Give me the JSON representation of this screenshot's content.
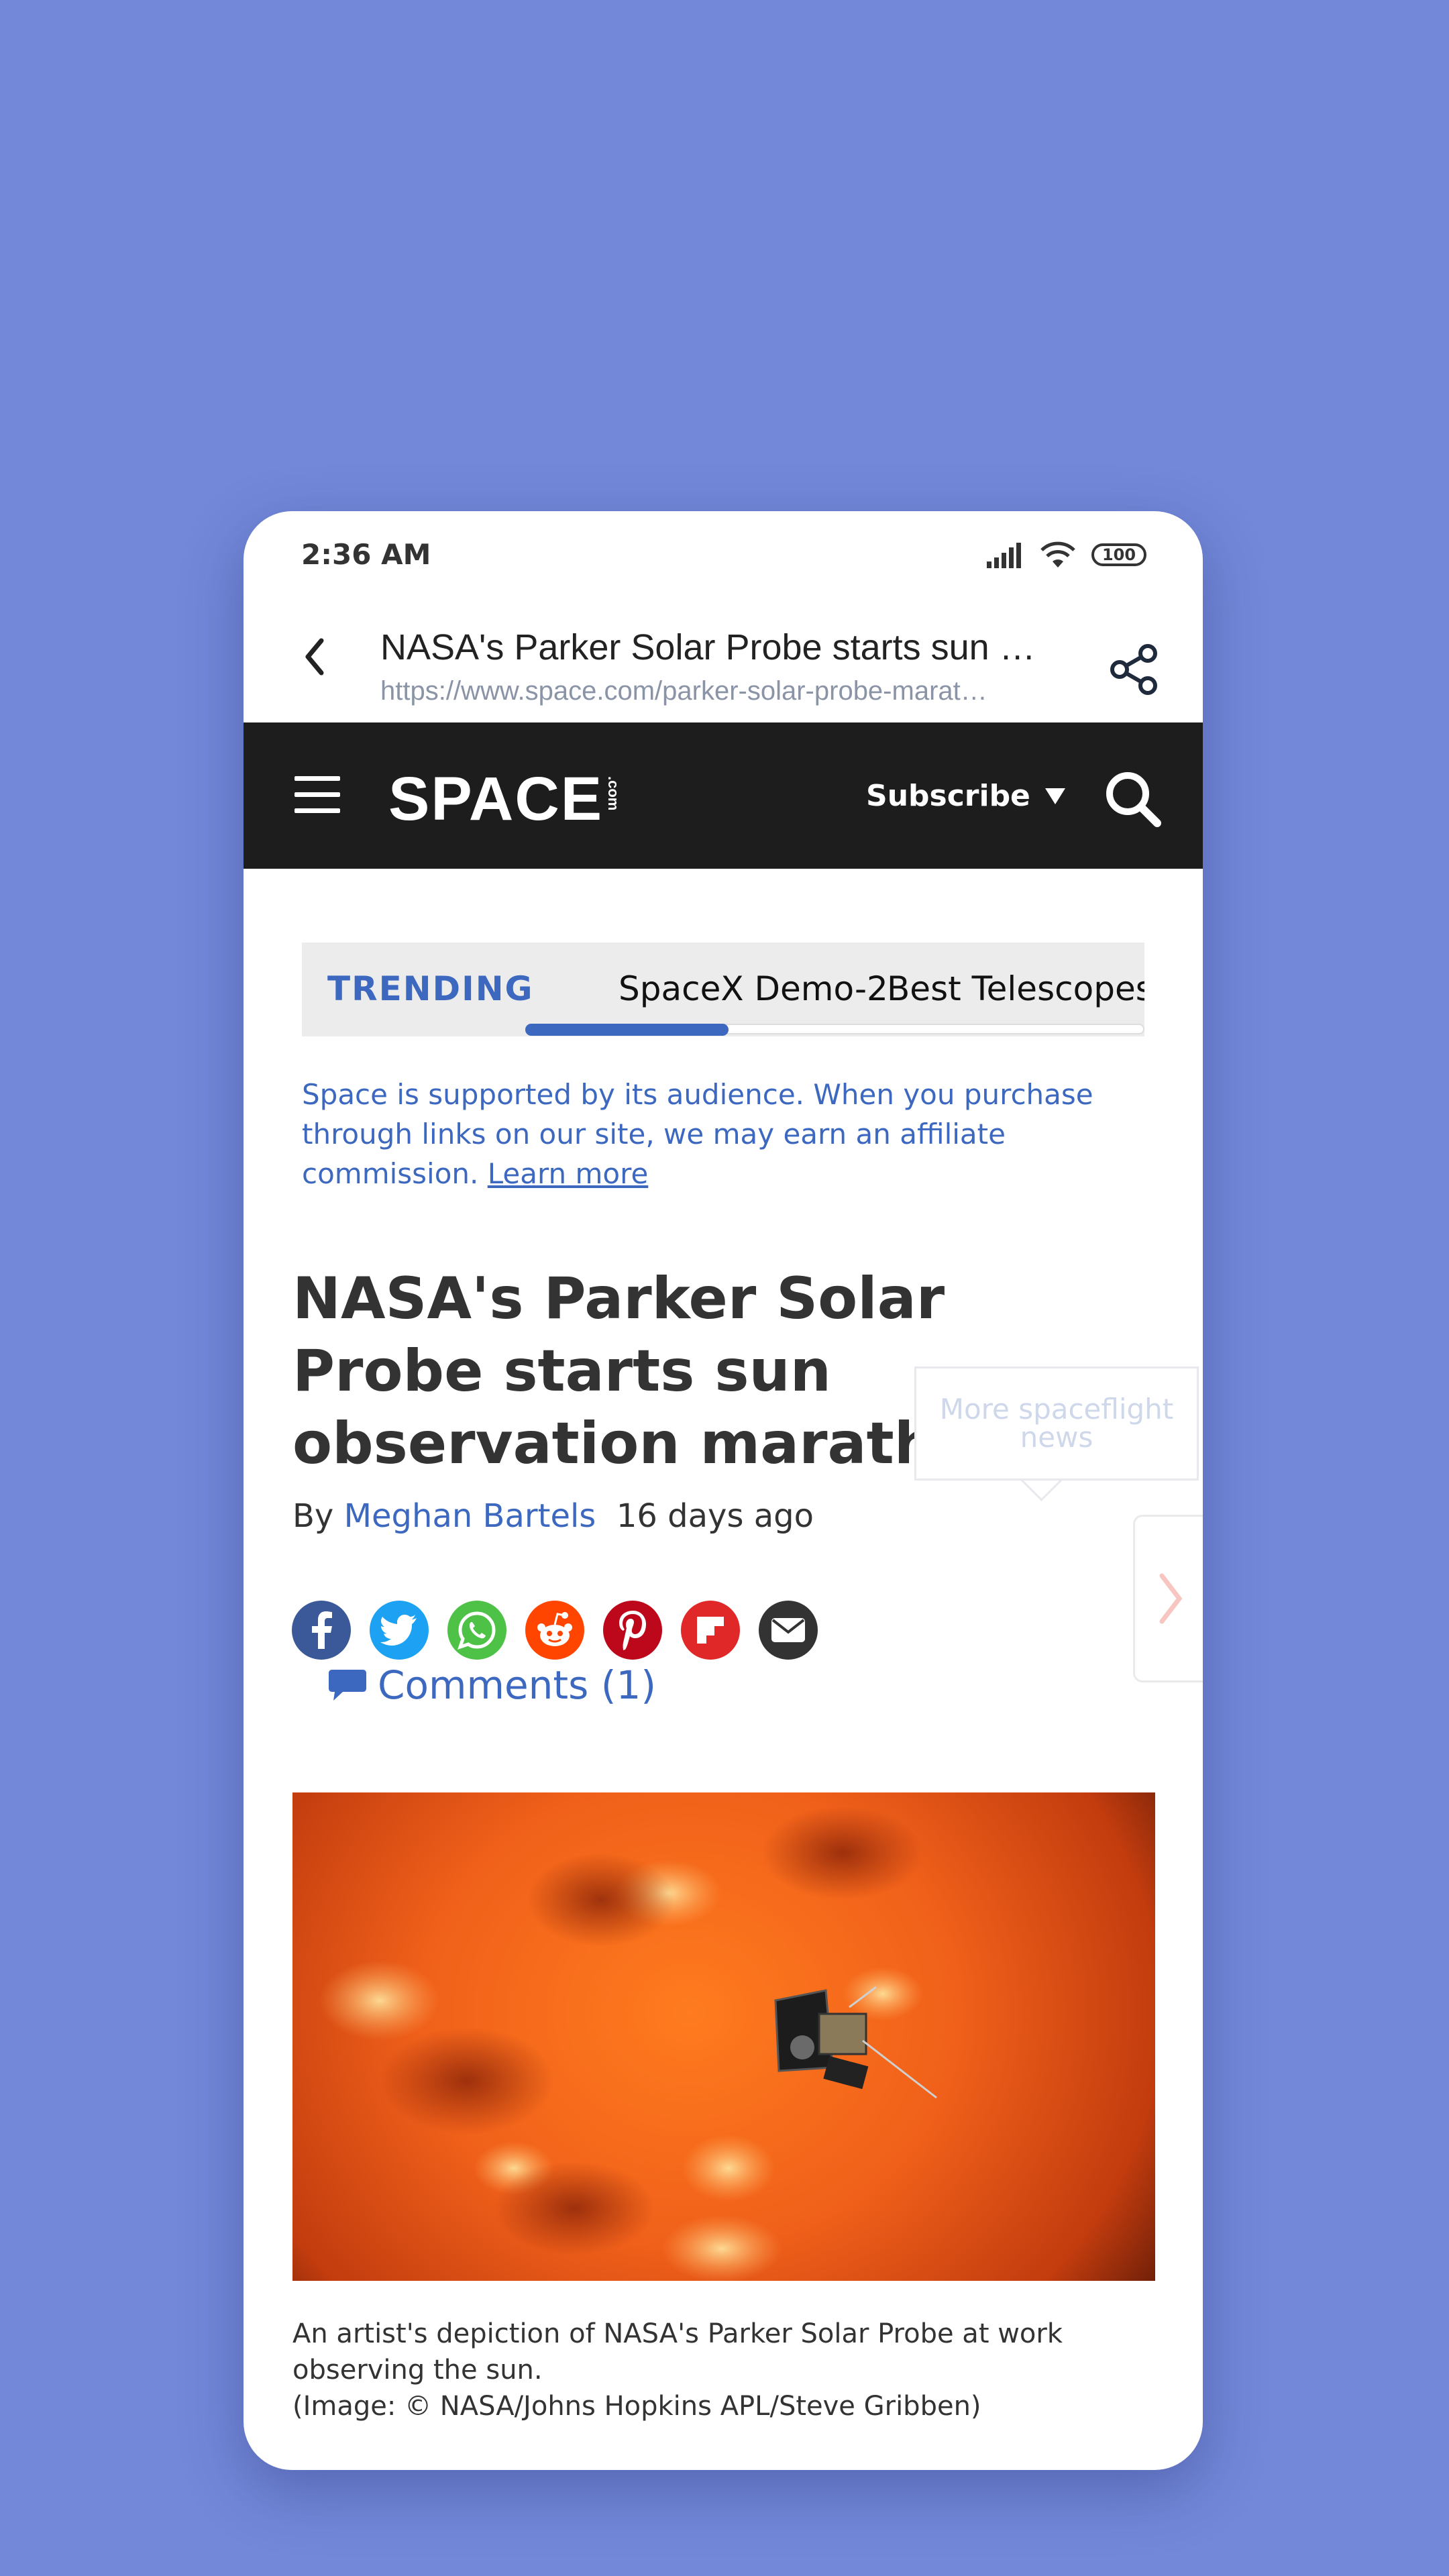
{
  "status_bar": {
    "time": "2:36 AM",
    "battery": "100"
  },
  "browser": {
    "page_title": "NASA's Parker Solar Probe starts sun o…",
    "url": "https://www.space.com/parker-solar-probe-marat…"
  },
  "site_header": {
    "logo_text": "SPACE",
    "logo_suffix": ".com",
    "subscribe_label": "Subscribe"
  },
  "trending": {
    "label": "TRENDING",
    "items": [
      "SpaceX Demo-2",
      "Best Telescopes"
    ]
  },
  "affiliate": {
    "text": "Space is supported by its audience. When you purchase through links on our site, we may earn an affiliate commission.",
    "link_label": "Learn more"
  },
  "article": {
    "headline": "NASA's Parker Solar Probe starts sun observation marathon",
    "by": "By",
    "author": "Meghan Bartels",
    "time_ago": "16 days ago",
    "comments_label": "Comments (1)",
    "caption_line1": "An artist's depiction of NASA's Parker Solar Probe at work observing the sun.",
    "caption_line2": "(Image: © NASA/Johns Hopkins APL/Steve Gribben)"
  },
  "more_box": {
    "label": "More spaceflight news"
  },
  "social": [
    {
      "name": "facebook-icon",
      "color": "#3b5998"
    },
    {
      "name": "twitter-icon",
      "color": "#1da1f2"
    },
    {
      "name": "whatsapp-icon",
      "color": "#4dc247"
    },
    {
      "name": "reddit-icon",
      "color": "#ff4500"
    },
    {
      "name": "pinterest-icon",
      "color": "#bd081c"
    },
    {
      "name": "flipboard-icon",
      "color": "#e12828"
    },
    {
      "name": "email-icon",
      "color": "#333333"
    }
  ],
  "colors": {
    "background": "#7388d9",
    "accent": "#3d68c0",
    "header": "#1d1d1d"
  }
}
